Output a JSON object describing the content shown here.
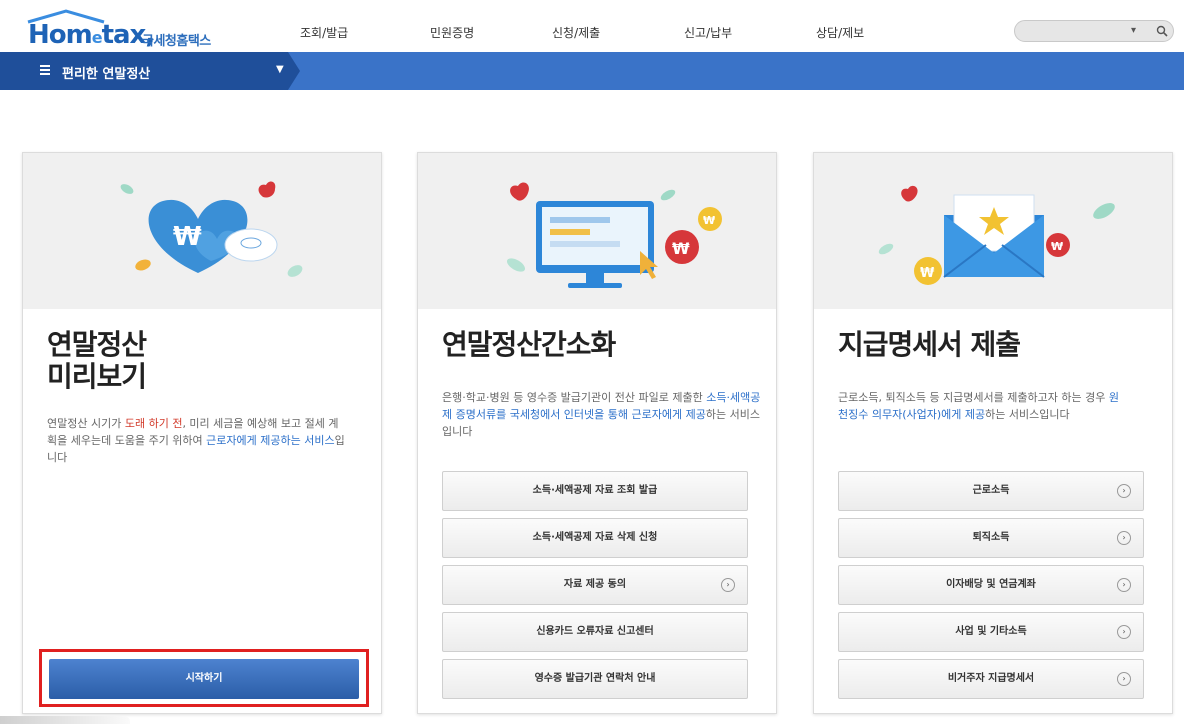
{
  "header": {
    "logo_brand_a": "Hom",
    "logo_brand_e": "e",
    "logo_brand_b": "tax,",
    "logo_sub": "국세청홈택스",
    "nav": [
      "조회/발급",
      "민원증명",
      "신청/제출",
      "신고/납부",
      "상담/제보"
    ],
    "search_placeholder": ""
  },
  "subnav": {
    "label": "편리한 연말정산"
  },
  "cards": [
    {
      "title_line1": "연말정산",
      "title_line2": "미리보기",
      "desc": {
        "p1": "연말정산 시기가 ",
        "red": "도래 하기 전",
        "p2": ", 미리 세금을 예상해 보고 절세 계획을 세우는데 도움을 주기 위하여 ",
        "blue": "근로자에게 제공하는 서비스",
        "p3": "입니다"
      },
      "start_label": "시작하기"
    },
    {
      "title": "연말정산간소화",
      "desc": {
        "p1": "은행·학교·병원 등 영수증 발급기관이 전산 파일로 제출한 ",
        "blue": "소득·세액공제 증명서류를 국세청에서 인터넷을 통해 근로자에게 제공",
        "p2": "하는 서비스입니다"
      },
      "buttons": [
        "소득·세액공제 자료 조회 발급",
        "소득·세액공제 자료 삭제 신청",
        "자료 제공 동의",
        "신용카드 오류자료 신고센터",
        "영수증 발급기관 연락처 안내"
      ]
    },
    {
      "title": "지급명세서 제출",
      "desc": {
        "p1": "근로소득, 퇴직소득 등 지급명세서를 제출하고자 하는 경우 ",
        "blue": "원천징수 의무자(사업자)에게 제공",
        "p2": "하는 서비스입니다"
      },
      "buttons": [
        "근로소득",
        "퇴직소득",
        "이자배당 및 연금계좌",
        "사업 및 기타소득",
        "비거주자 지급명세서"
      ]
    }
  ],
  "colors": {
    "brand_blue": "#1e63b6",
    "subnav_blue": "#3a73c8",
    "subnav_dark": "#1f4f9a",
    "highlight_red": "#e02020",
    "start_button": "#2b5ea8"
  },
  "icons": [
    "menu-icon",
    "caret-down-icon",
    "search-icon",
    "arrow-circle-icon",
    "wallet-heart-icon",
    "monitor-icon",
    "envelope-icon",
    "won-coin-icon"
  ]
}
